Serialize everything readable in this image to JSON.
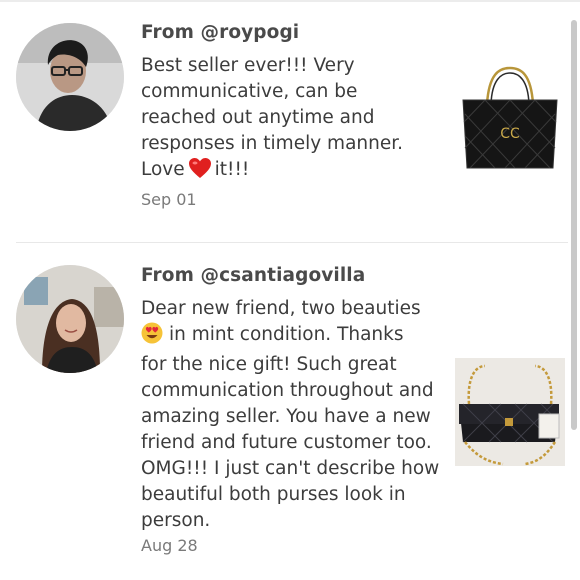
{
  "reviews": [
    {
      "from": "From @roypogi",
      "lines": [
        "Best seller ever!!! Very",
        "communicative, can be",
        "reached out anytime and",
        "responses in timely manner.",
        "Love"
      ],
      "line5_tail": "it!!!",
      "emoji": "heart-emoji",
      "date": "Sep 01",
      "photo": "quilted-tote-bag-photo"
    },
    {
      "from": "From @csantiagovilla",
      "lines": [
        "Dear new friend, two beauties",
        "in mint condition. Thanks",
        "for the nice gift! Such great",
        "communication throughout and",
        "amazing seller. You have a new",
        "friend and future customer too.",
        "OMG!!! I just can't describe how",
        "beautiful both purses look in",
        "person."
      ],
      "emoji": "heart-eyes-emoji",
      "date": "Aug 28",
      "photo": "quilted-flap-bag-photo"
    }
  ],
  "colors": {
    "text": "#3c3c3c",
    "username": "#4a4a4a",
    "date": "#7a7a7a",
    "divider": "#e8e8e8",
    "heart": "#e0201f"
  }
}
